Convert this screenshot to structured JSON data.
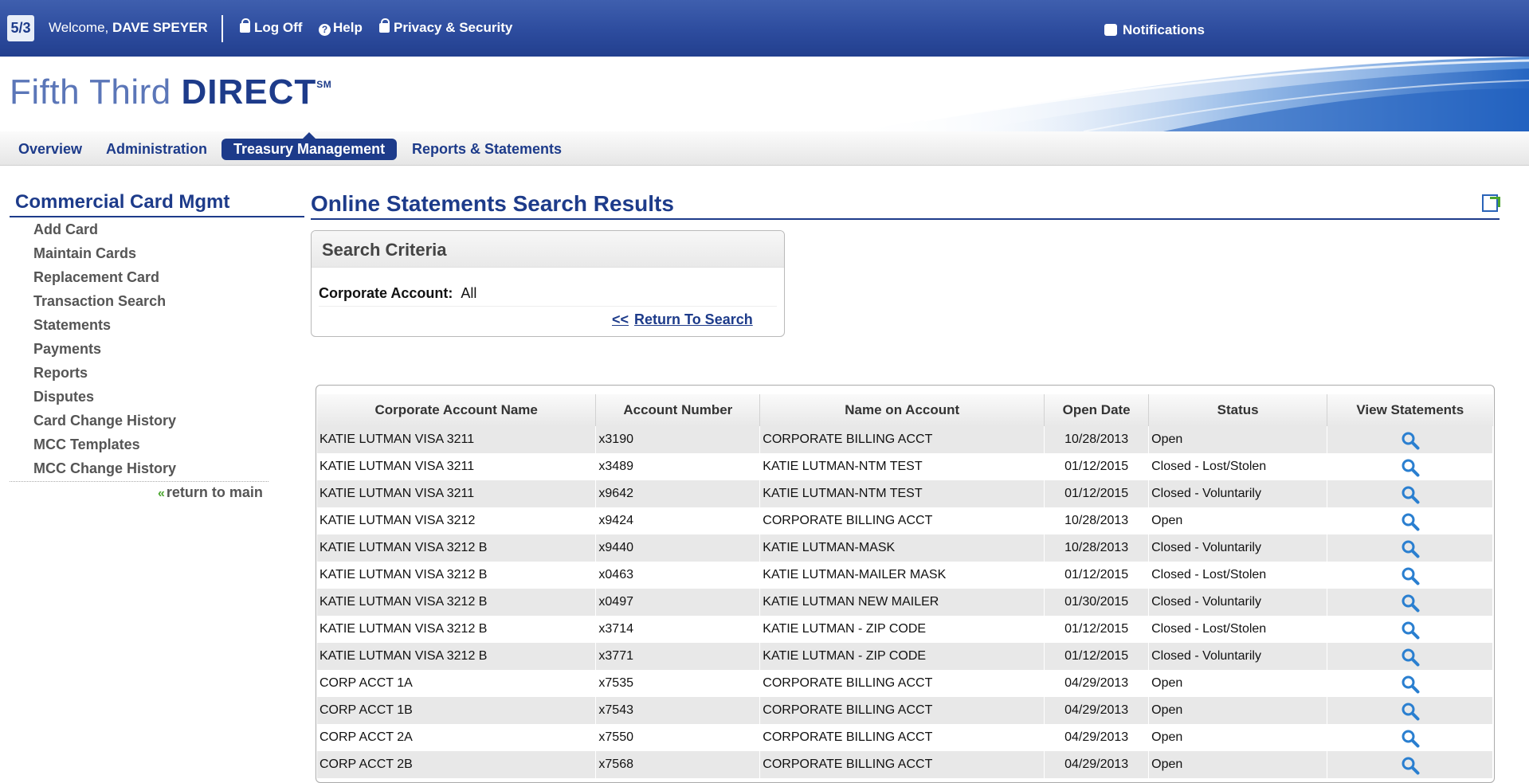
{
  "header": {
    "welcome_prefix": "Welcome,",
    "user_name": "DAVE SPEYER",
    "log_off": "Log Off",
    "help": "Help",
    "privacy": "Privacy & Security",
    "notifications": "Notifications",
    "logo_mark": "5/3"
  },
  "brand": {
    "name_light": "Fifth Third",
    "name_bold": "DIRECT",
    "mark": "SM"
  },
  "nav": {
    "items": [
      "Overview",
      "Administration",
      "Treasury Management",
      "Reports & Statements"
    ],
    "active": "Treasury Management"
  },
  "sidebar": {
    "title": "Commercial Card Mgmt",
    "items": [
      "Add Card",
      "Maintain Cards",
      "Replacement Card",
      "Transaction Search",
      "Statements",
      "Payments",
      "Reports",
      "Disputes",
      "Card Change History",
      "MCC Templates",
      "MCC Change History"
    ],
    "return_main": "return to main"
  },
  "main": {
    "title": "Online Statements Search Results",
    "criteria": {
      "heading": "Search Criteria",
      "label": "Corporate Account:",
      "value": "All",
      "return_arrows": "<<",
      "return_label": "Return To Search"
    },
    "table": {
      "columns": [
        "Corporate Account Name",
        "Account Number",
        "Name on Account",
        "Open Date",
        "Status",
        "View Statements"
      ],
      "rows": [
        [
          "KATIE LUTMAN VISA 3211",
          "x3190",
          "CORPORATE BILLING ACCT",
          "10/28/2013",
          "Open"
        ],
        [
          "KATIE LUTMAN VISA 3211",
          "x3489",
          "KATIE LUTMAN-NTM TEST",
          "01/12/2015",
          "Closed - Lost/Stolen"
        ],
        [
          "KATIE LUTMAN VISA 3211",
          "x9642",
          "KATIE LUTMAN-NTM TEST",
          "01/12/2015",
          "Closed - Voluntarily"
        ],
        [
          "KATIE LUTMAN VISA 3212",
          "x9424",
          "CORPORATE BILLING ACCT",
          "10/28/2013",
          "Open"
        ],
        [
          "KATIE LUTMAN VISA 3212 B",
          "x9440",
          "KATIE LUTMAN-MASK",
          "10/28/2013",
          "Closed - Voluntarily"
        ],
        [
          "KATIE LUTMAN VISA 3212 B",
          "x0463",
          "KATIE LUTMAN-MAILER MASK",
          "01/12/2015",
          "Closed - Lost/Stolen"
        ],
        [
          "KATIE LUTMAN VISA 3212 B",
          "x0497",
          "KATIE LUTMAN NEW MAILER",
          "01/30/2015",
          "Closed - Voluntarily"
        ],
        [
          "KATIE LUTMAN VISA 3212 B",
          "x3714",
          "KATIE LUTMAN - ZIP CODE",
          "01/12/2015",
          "Closed - Lost/Stolen"
        ],
        [
          "KATIE LUTMAN VISA 3212 B",
          "x3771",
          "KATIE LUTMAN - ZIP CODE",
          "01/12/2015",
          "Closed - Voluntarily"
        ],
        [
          "CORP ACCT 1A",
          "x7535",
          "CORPORATE BILLING ACCT",
          "04/29/2013",
          "Open"
        ],
        [
          "CORP ACCT 1B",
          "x7543",
          "CORPORATE BILLING ACCT",
          "04/29/2013",
          "Open"
        ],
        [
          "CORP ACCT 2A",
          "x7550",
          "CORPORATE BILLING ACCT",
          "04/29/2013",
          "Open"
        ],
        [
          "CORP ACCT 2B",
          "x7568",
          "CORPORATE BILLING ACCT",
          "04/29/2013",
          "Open"
        ]
      ]
    }
  },
  "colors": {
    "brand_blue": "#1d3b8a",
    "header_blue": "#2d4c9e",
    "accent_green": "#4aa52e",
    "row_alt": "#e8e8e8",
    "search_icon": "#2a7fd0"
  }
}
